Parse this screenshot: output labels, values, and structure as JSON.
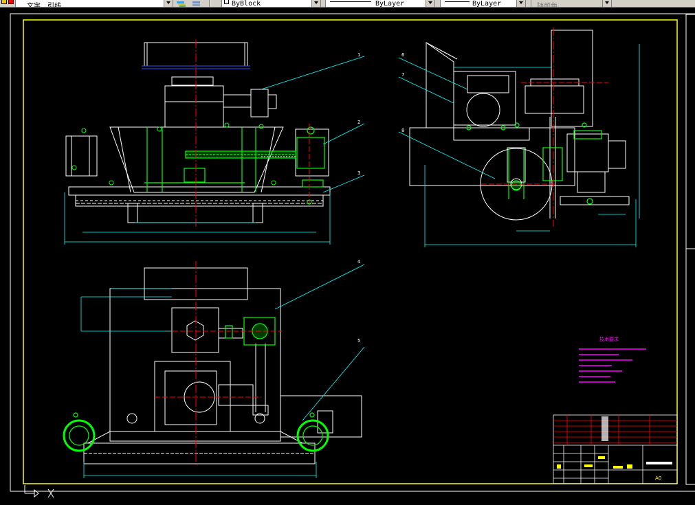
{
  "toolbar": {
    "text_style": "文字、引线",
    "layer": "ByBlock",
    "linetype": "ByLayer",
    "lineweight": "ByLayer",
    "color": "随颜色"
  },
  "drawing": {
    "callouts": [
      "1",
      "2",
      "3",
      "4",
      "5",
      "6",
      "7",
      "8"
    ],
    "tech_title": "技术要求",
    "sheet_size": "A0"
  },
  "colors": {
    "background": "#000000",
    "frame": "#ffff00",
    "body": "#ffffff",
    "gear": "#00ff00",
    "center": "#ff0000",
    "dimension": "#00ffff",
    "center_blue": "#3050ff",
    "notes": "#ff00ff"
  },
  "icons": [
    "layer-state-icon",
    "lock-icon",
    "color-swatch-icon",
    "layer-manager-icon",
    "layer-previous-icon"
  ]
}
